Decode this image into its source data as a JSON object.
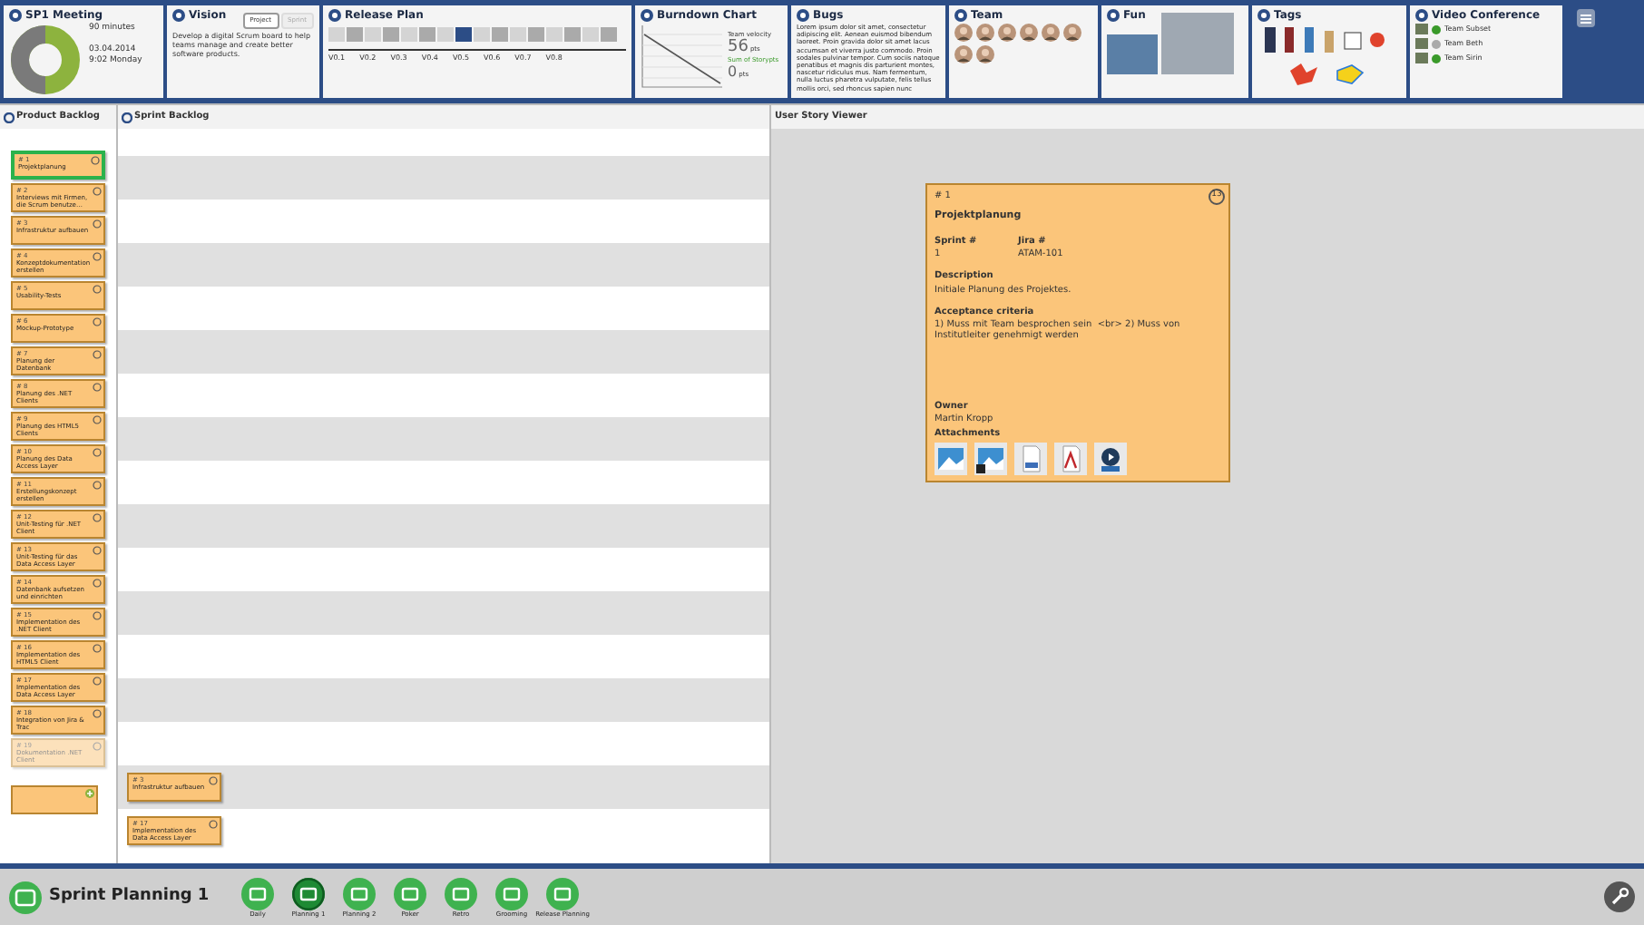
{
  "meeting": {
    "title": "SP1 Meeting",
    "duration": "90 minutes",
    "date": "03.04.2014",
    "time": "9:02 Monday"
  },
  "vision": {
    "title": "Vision",
    "tabs": [
      {
        "label": "Project",
        "selected": true
      },
      {
        "label": "Sprint",
        "selected": false
      }
    ],
    "text": "Develop a digital Scrum board to help teams manage and create better software products."
  },
  "release_plan": {
    "title": "Release Plan",
    "sprints": [
      {
        "selected": false
      },
      {
        "selected": false
      },
      {
        "selected": false
      },
      {
        "selected": false
      },
      {
        "selected": false
      },
      {
        "selected": false
      },
      {
        "selected": false
      },
      {
        "selected": true
      },
      {
        "selected": false
      },
      {
        "selected": false
      },
      {
        "selected": false
      },
      {
        "selected": false
      },
      {
        "selected": false
      },
      {
        "selected": false
      },
      {
        "selected": false
      },
      {
        "selected": false
      }
    ],
    "versions": [
      "V0.1",
      "V0.2",
      "V0.3",
      "V0.4",
      "V0.5",
      "V0.6",
      "V0.7",
      "V0.8"
    ]
  },
  "burndown": {
    "title": "Burndown Chart",
    "velocity_label": "Team velocity",
    "velocity": "56",
    "velocity_unit": "pts",
    "sum_label": "Sum of Storypts",
    "sum": "0",
    "sum_unit": "pts"
  },
  "bugs": {
    "title": "Bugs",
    "text": "Lorem ipsum dolor sit amet, consectetur adipiscing elit. Aenean euismod bibendum laoreet. Proin gravida dolor sit amet lacus accumsan et viverra justo commodo. Proin sodales pulvinar tempor. Cum sociis natoque penatibus et magnis dis parturient montes, nascetur ridiculus mus. Nam fermentum, nulla luctus pharetra vulputate, felis tellus mollis orci, sed rhoncus sapien nunc"
  },
  "team": {
    "title": "Team",
    "members": [
      {
        "kind": "avatar"
      },
      {
        "kind": "avatar"
      },
      {
        "kind": "avatar"
      },
      {
        "kind": "avatar"
      },
      {
        "kind": "avatar"
      },
      {
        "kind": "avatar"
      },
      {
        "kind": "avatar"
      },
      {
        "kind": "avatar"
      }
    ]
  },
  "fun": {
    "title": "Fun"
  },
  "tags": {
    "title": "Tags"
  },
  "video": {
    "title": "Video Conference",
    "teams": [
      {
        "name": "Team Subset",
        "online": true
      },
      {
        "name": "Team Beth",
        "online": false
      },
      {
        "name": "Team Sirin",
        "online": true
      }
    ]
  },
  "product_backlog": {
    "title": "Product Backlog",
    "items": [
      {
        "number": "# 1",
        "title": "Projektplanung",
        "selected": true,
        "dimmed": false
      },
      {
        "number": "# 2",
        "title": "Interviews mit Firmen, die Scrum benutze…",
        "selected": false,
        "dimmed": false
      },
      {
        "number": "# 3",
        "title": "Infrastruktur aufbauen",
        "selected": false,
        "dimmed": false
      },
      {
        "number": "# 4",
        "title": "Konzeptdokumentation erstellen",
        "selected": false,
        "dimmed": false
      },
      {
        "number": "# 5",
        "title": "Usability-Tests",
        "selected": false,
        "dimmed": false
      },
      {
        "number": "# 6",
        "title": "Mockup-Prototype",
        "selected": false,
        "dimmed": false
      },
      {
        "number": "# 7",
        "title": "Planung der Datenbank",
        "selected": false,
        "dimmed": false
      },
      {
        "number": "# 8",
        "title": "Planung des .NET Clients",
        "selected": false,
        "dimmed": false
      },
      {
        "number": "# 9",
        "title": "Planung des HTML5 Clients",
        "selected": false,
        "dimmed": false
      },
      {
        "number": "# 10",
        "title": "Planung des Data Access Layer",
        "selected": false,
        "dimmed": false
      },
      {
        "number": "# 11",
        "title": "Erstellungskonzept erstellen",
        "selected": false,
        "dimmed": false
      },
      {
        "number": "# 12",
        "title": "Unit-Testing für .NET Client",
        "selected": false,
        "dimmed": false
      },
      {
        "number": "# 13",
        "title": "Unit-Testing für das Data Access Layer",
        "selected": false,
        "dimmed": false
      },
      {
        "number": "# 14",
        "title": "Datenbank aufsetzen und einrichten",
        "selected": false,
        "dimmed": false
      },
      {
        "number": "# 15",
        "title": "Implementation des .NET Client",
        "selected": false,
        "dimmed": false
      },
      {
        "number": "# 16",
        "title": "Implementation des HTML5 Client",
        "selected": false,
        "dimmed": false
      },
      {
        "number": "# 17",
        "title": "Implementation des Data Access Layer",
        "selected": false,
        "dimmed": false
      },
      {
        "number": "# 18",
        "title": "Integration von Jira & Trac",
        "selected": false,
        "dimmed": false
      },
      {
        "number": "# 19",
        "title": "Dokumentation .NET Client",
        "selected": false,
        "dimmed": true
      }
    ]
  },
  "sprint_backlog": {
    "title": "Sprint Backlog",
    "items": [
      {
        "number": "# 3",
        "title": "Infrastruktur aufbauen"
      },
      {
        "number": "# 17",
        "title": "Implementation des Data Access Layer"
      }
    ]
  },
  "viewer": {
    "title": "User Story Viewer",
    "story": {
      "number": "# 1",
      "title": "Projektplanung",
      "points": "13",
      "sprint_label": "Sprint #",
      "sprint": "1",
      "jira_label": "Jira #",
      "jira": "ATAM-101",
      "description_label": "Description",
      "description": "Initiale Planung des Projektes.",
      "criteria_label": "Acceptance criteria",
      "criteria": "1) Muss mit Team besprochen sein  <br> 2) Muss von Institutleiter genehmigt werden",
      "owner_label": "Owner",
      "owner": "Martin Kropp",
      "attachments_label": "Attachments",
      "attachments": [
        {
          "kind": "image"
        },
        {
          "kind": "video"
        },
        {
          "kind": "word"
        },
        {
          "kind": "pdf"
        },
        {
          "kind": "media"
        }
      ]
    }
  },
  "bottom_bar": {
    "title": "Sprint Planning 1",
    "views": [
      {
        "label": "Daily",
        "selected": false
      },
      {
        "label": "Planning 1",
        "selected": true
      },
      {
        "label": "Planning 2",
        "selected": false
      },
      {
        "label": "Poker",
        "selected": false
      },
      {
        "label": "Retro",
        "selected": false
      },
      {
        "label": "Grooming",
        "selected": false
      },
      {
        "label": "Release Planning",
        "selected": false
      }
    ]
  }
}
